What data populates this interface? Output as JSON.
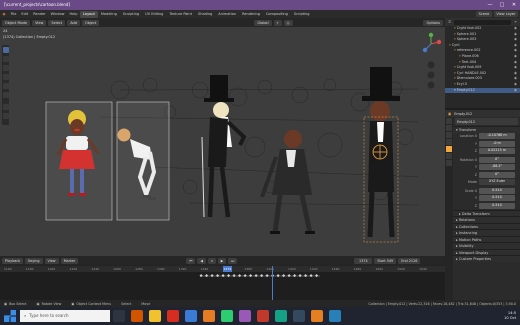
{
  "window": {
    "title": "[\\current_projects\\cartoon.blend]",
    "minimize": "—",
    "maximize": "□",
    "close": "✕"
  },
  "menubar": {
    "menus": [
      "File",
      "Edit",
      "Render",
      "Window",
      "Help"
    ],
    "workspaces": [
      "Layout",
      "Modeling",
      "Sculpting",
      "UV Editing",
      "Texture Paint",
      "Shading",
      "Animation",
      "Rendering",
      "Compositing",
      "Scripting"
    ],
    "scene": "Scene",
    "view_layer": "View Layer"
  },
  "viewport_header": {
    "mode": "Object Mode",
    "menus": [
      "View",
      "Select",
      "Add",
      "Object"
    ],
    "orientation": "Global",
    "options": "Options",
    "frame_label": "24",
    "info_line": "(1374) Collection | Empty.012"
  },
  "outliner": {
    "rows": [
      {
        "label": "Crght foot.002",
        "indent": 1
      },
      {
        "label": "Sphere.001",
        "indent": 1
      },
      {
        "label": "Sphere.003",
        "indent": 1
      },
      {
        "label": "Cyril",
        "indent": 0
      },
      {
        "label": "reference.002",
        "indent": 1
      },
      {
        "label": "Plane.006",
        "indent": 2
      },
      {
        "label": "Text.004",
        "indent": 2
      },
      {
        "label": "Crght foot.009",
        "indent": 1
      },
      {
        "label": "Cyrl HANDLE.002",
        "indent": 1
      },
      {
        "label": "Dlemulare.003",
        "indent": 1
      },
      {
        "label": "Ecyl.5",
        "indent": 1
      },
      {
        "label": "Empty.012",
        "indent": 1,
        "selected": true
      }
    ]
  },
  "properties": {
    "search_object": "Empty.012",
    "object_name": "Empty.012",
    "transform_header": "Transform",
    "location_label": "Location X",
    "location": [
      "-0.10768 m",
      "-0 m",
      "0.02215 m"
    ],
    "rotation_label": "Rotation X",
    "rotation": [
      "0°",
      "-88.2°",
      "0°"
    ],
    "mode_label": "Mode",
    "mode": "XYZ Euler",
    "scale_label": "Scale X",
    "scale": [
      "0.514",
      "0.514",
      "0.514"
    ],
    "axis_y": "Y",
    "axis_z": "Z",
    "delta_transform": "Delta Transform",
    "sections": [
      "Relations",
      "Collections",
      "Instancing",
      "Motion Paths",
      "Visibility",
      "Viewport Display",
      "Custom Properties"
    ]
  },
  "timeline": {
    "header_menus": [
      "Playback",
      "Keying",
      "View",
      "Marker"
    ],
    "current_frame": "1374",
    "start_label": "Start",
    "start": "549",
    "end_label": "End",
    "end": "2126",
    "ticks": [
      "1160",
      "1180",
      "1200",
      "1220",
      "1240",
      "1260",
      "1280",
      "1300",
      "1320",
      "1340",
      "1374",
      "1380",
      "1400",
      "1420",
      "1440",
      "1460",
      "1480",
      "1500",
      "1520",
      "1540"
    ]
  },
  "statusbar": {
    "left_items": [
      "Box Select",
      "Rotate View",
      "Object Context Menu",
      "Select",
      "Move"
    ],
    "stats": "Collection | Empty.012 | Verts:22,316 | Faces:18,482 | Tris:31,648 | Objects:0/353 | 3.90.0"
  },
  "taskbar": {
    "search_placeholder": "Type here to search",
    "time": "14:5",
    "date": "10 Oct"
  },
  "colors": {
    "title_bar": "#6a4a86",
    "viewport_bg": "#3d3d3d",
    "selection_orange": "#f4a640",
    "selected_row": "#3f5b86",
    "playhead": "#4a7bd0"
  }
}
